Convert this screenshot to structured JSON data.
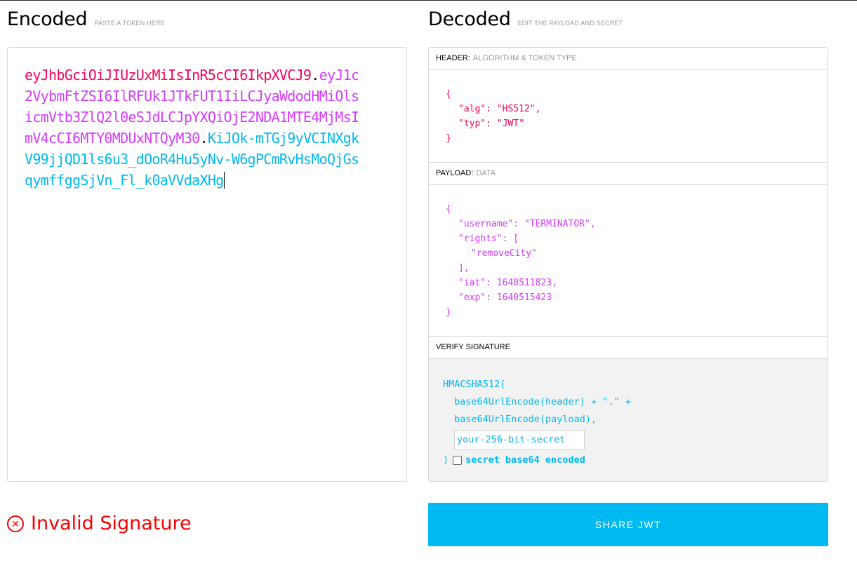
{
  "encoded": {
    "title": "Encoded",
    "hint": "PASTE A TOKEN HERE",
    "token_header": "eyJhbGciOiJIUzUxMiIsInR5cCI6IkpXVCJ9",
    "token_payload": "eyJ1c2VybmFtZSI6IlRFUk1JTkFUT1IiLCJyaWdodHMiOlsicmVtb3ZlQ2l0eSJdLCJpYXQiOjE2NDA1MTE4MjMsImV4cCI6MTY0MDUxNTQyM30",
    "token_signature": "KiJOk-mTGj9yVCINXgkV99jjQD1ls6u3_dOoR4Hu5yNv-W6gPCmRvHsMoQjGsqymffggSjVn_Fl_k0aVVdaXHg",
    "dot": "."
  },
  "decoded": {
    "title": "Decoded",
    "hint": "EDIT THE PAYLOAD AND SECRET",
    "header_section": {
      "label": "HEADER:",
      "sub": "ALGORITHM & TOKEN TYPE",
      "lines": [
        "{",
        "\"alg\": \"HS512\",",
        "\"typ\": \"JWT\"",
        "}"
      ]
    },
    "payload_section": {
      "label": "PAYLOAD:",
      "sub": "DATA",
      "lines": [
        "{",
        "\"username\": \"TERMINATOR\",",
        "\"rights\": [",
        "\"removeCity\"",
        "],",
        "\"iat\": 1640511823,",
        "\"exp\": 1640515423",
        "}"
      ]
    },
    "signature_section": {
      "label": "VERIFY SIGNATURE",
      "line1": "HMACSHA512(",
      "line2": "base64UrlEncode(header) + \".\" +",
      "line3": "base64UrlEncode(payload),",
      "secret_placeholder": "your-256-bit-secret",
      "close_paren": ")",
      "checkbox_label": "secret base64 encoded"
    }
  },
  "status": {
    "icon": "close-circle-icon",
    "text": "Invalid Signature",
    "color": "#fb0000"
  },
  "share_button": {
    "label": "SHARE JWT"
  },
  "colors": {
    "header": "#fb015b",
    "payload": "#d63aff",
    "signature": "#00b9f1"
  }
}
